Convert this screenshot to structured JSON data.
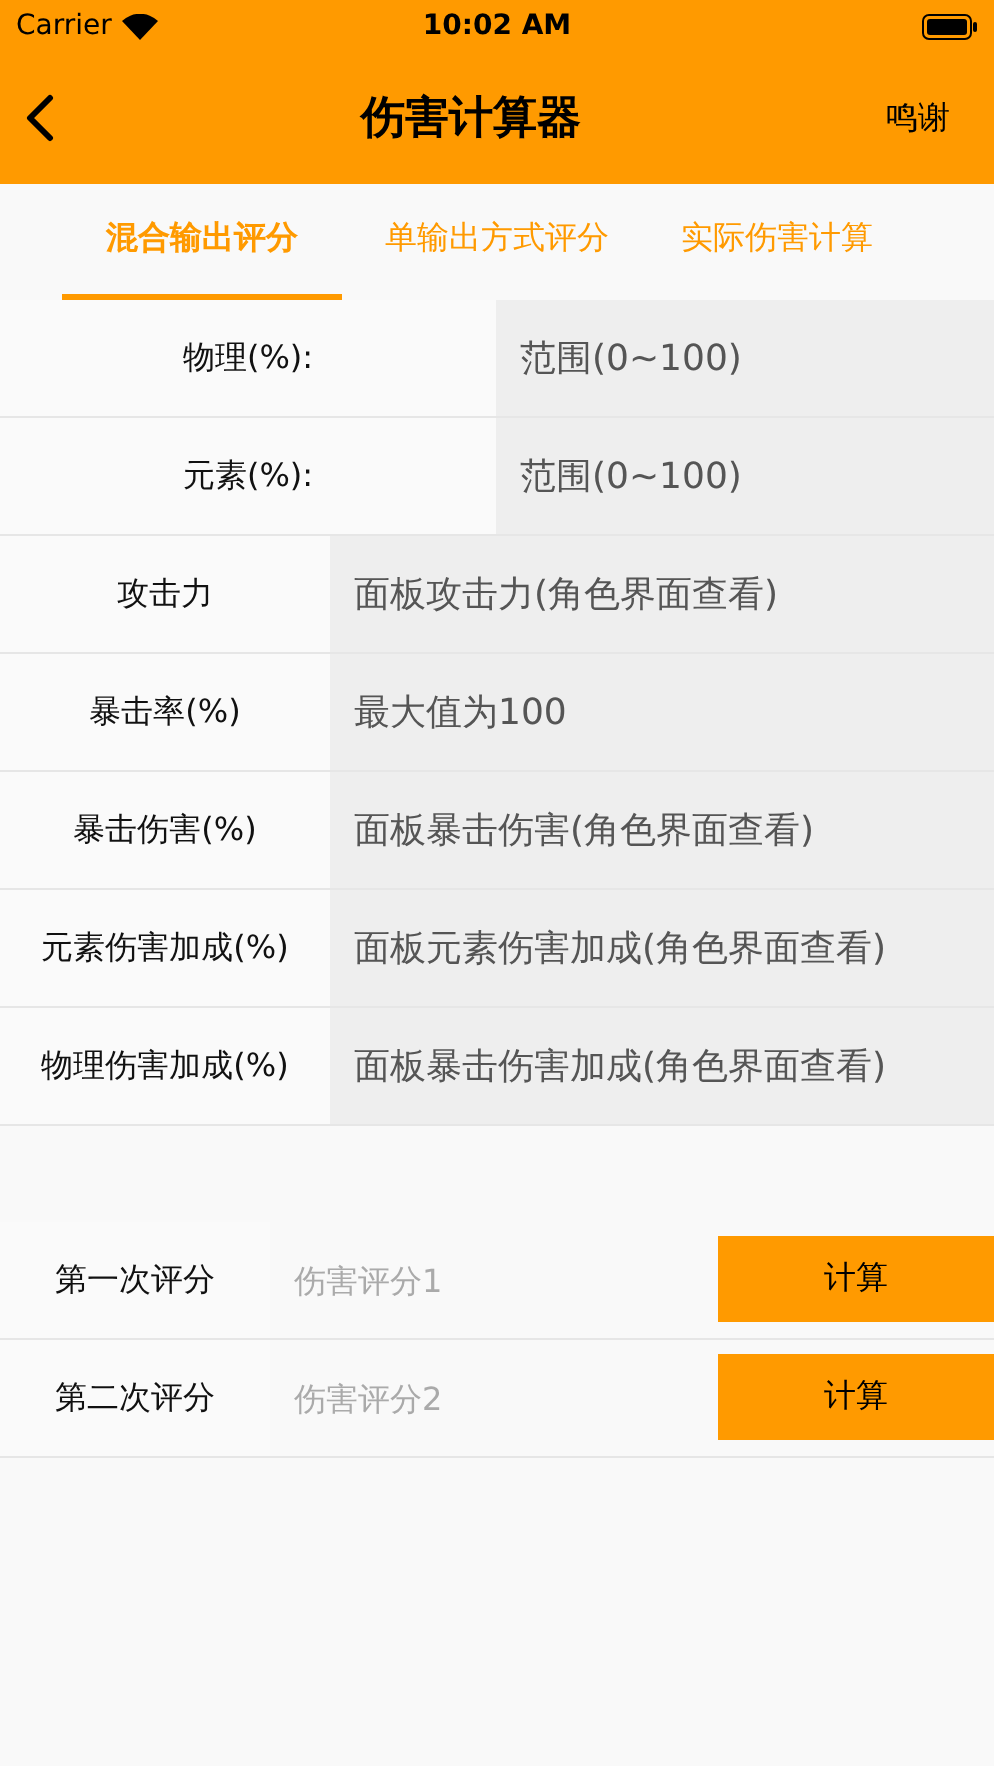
{
  "status_bar": {
    "carrier": "Carrier",
    "time": "10:02 AM"
  },
  "nav": {
    "title": "伤害计算器",
    "action": "鸣谢"
  },
  "tabs": [
    {
      "label": "混合输出评分",
      "selected": true
    },
    {
      "label": "单输出方式评分",
      "selected": false
    },
    {
      "label": "实际伤害计算",
      "selected": false
    }
  ],
  "ratio_fields": [
    {
      "label": "物理(%):",
      "placeholder": "范围(0~100)"
    },
    {
      "label": "元素(%):",
      "placeholder": "范围(0~100)"
    }
  ],
  "stat_fields": [
    {
      "label": "攻击力",
      "placeholder": "面板攻击力(角色界面查看)"
    },
    {
      "label": "暴击率(%)",
      "placeholder": "最大值为100"
    },
    {
      "label": "暴击伤害(%)",
      "placeholder": "面板暴击伤害(角色界面查看)"
    },
    {
      "label": "元素伤害加成(%)",
      "placeholder": "面板元素伤害加成(角色界面查看)"
    },
    {
      "label": "物理伤害加成(%)",
      "placeholder": "面板暴击伤害加成(角色界面查看)"
    }
  ],
  "scores": [
    {
      "label": "第一次评分",
      "placeholder": "伤害评分1",
      "button": "计算"
    },
    {
      "label": "第二次评分",
      "placeholder": "伤害评分2",
      "button": "计算"
    }
  ]
}
